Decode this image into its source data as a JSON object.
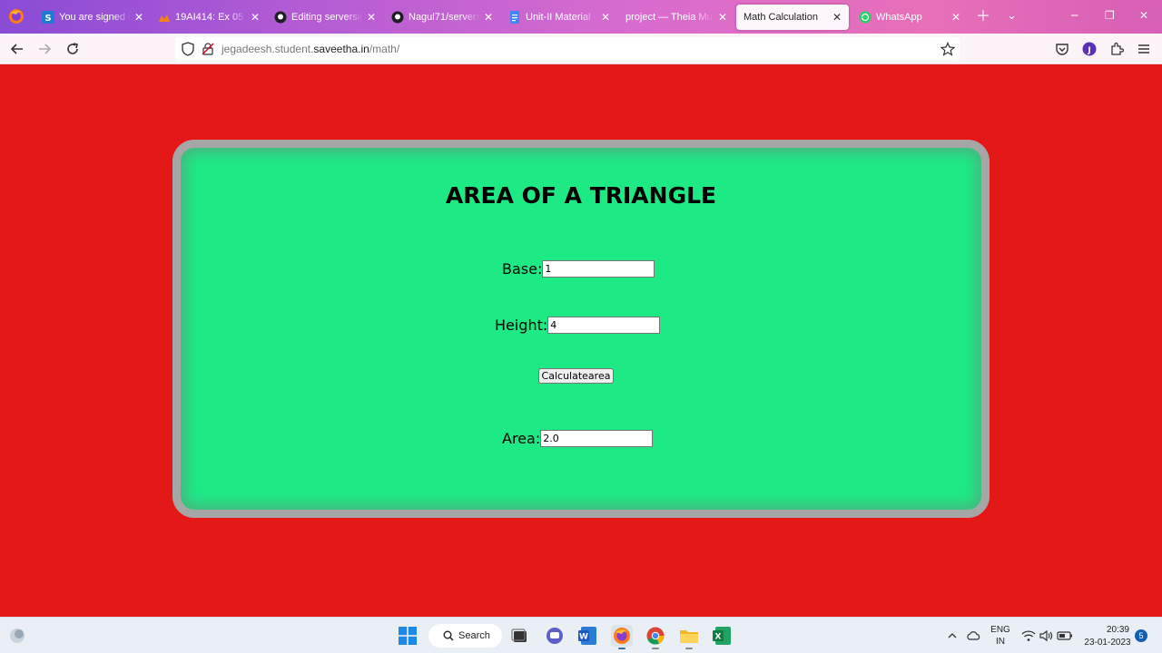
{
  "browser": {
    "tabs": [
      {
        "title": "You are signed in as",
        "favicon": "saveetha-s-icon",
        "active": false
      },
      {
        "title": "19AI414: Ex 05: De",
        "favicon": "moodle-icon",
        "active": false
      },
      {
        "title": "Editing serverside",
        "favicon": "github-icon",
        "active": false
      },
      {
        "title": "Nagul71/serverside",
        "favicon": "github-icon",
        "active": false
      },
      {
        "title": "Unit-II Material - G",
        "favicon": "docs-icon",
        "active": false
      },
      {
        "title": "project — Theia Multi",
        "favicon": "theia-icon",
        "active": false
      },
      {
        "title": "Math Calculation",
        "favicon": "",
        "active": true
      },
      {
        "title": "WhatsApp",
        "favicon": "whatsapp-icon",
        "active": false
      }
    ],
    "url": {
      "prefix": "jegadeesh.student.",
      "domain": "saveetha.in",
      "path": "/math/"
    },
    "profile_initial": "J"
  },
  "page": {
    "heading": "AREA OF A TRIANGLE",
    "base_label": "Base:",
    "base_value": "1",
    "height_label": "Height:",
    "height_value": "4",
    "button_label": "Calculatearea",
    "area_label": "Area:",
    "area_value": "2.0",
    "colors": {
      "background": "#e51818",
      "card": "#1dea85",
      "card_border": "#a6a6a6"
    }
  },
  "taskbar": {
    "search_label": "Search",
    "lang_line1": "ENG",
    "lang_line2": "IN",
    "time": "20:39",
    "date": "23-01-2023",
    "notification_count": "5"
  }
}
